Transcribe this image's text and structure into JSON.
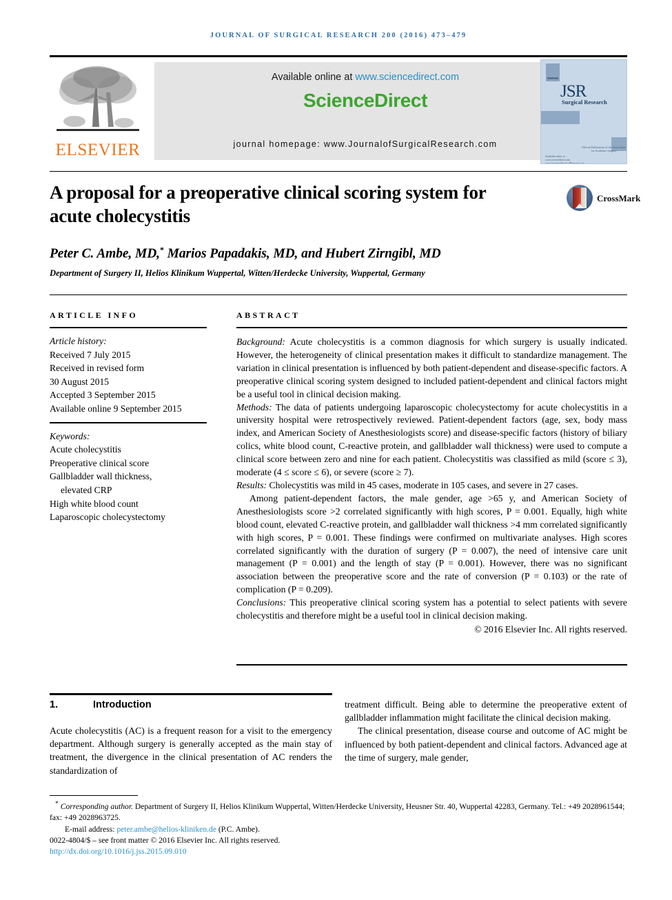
{
  "running_head": "JOURNAL OF SURGICAL RESEARCH 200 (2016) 473–479",
  "masthead": {
    "elsevier_wordmark": "ELSEVIER",
    "available_prefix": "Available online at ",
    "available_link": "www.sciencedirect.com",
    "sciencedirect_logo": "ScienceDirect",
    "journal_homepage": "journal homepage: www.JournalofSurgicalResearch.com",
    "cover": {
      "title": "JSR",
      "subtitle": "Surgical Research",
      "footer_line": "Official Publication of the Association for Academic Surgery",
      "footer_line2": "Available online at www.sciencedirect.com www.JournalofSurgicalResearch.com"
    }
  },
  "article": {
    "title": "A proposal for a preoperative clinical scoring system for acute cholecystitis",
    "crossmark_label": "CrossMark",
    "authors": "Peter C. Ambe, MD,",
    "authors_rest": " Marios Papadakis, MD, and Hubert Zirngibl, MD",
    "author_marker": "*",
    "affiliation": "Department of Surgery II, Helios Klinikum Wuppertal, Witten/Herdecke University, Wuppertal, Germany"
  },
  "article_info": {
    "heading": "ARTICLE INFO",
    "history_label": "Article history:",
    "history": [
      "Received 7 July 2015",
      "Received in revised form",
      "30 August 2015",
      "Accepted 3 September 2015",
      "Available online 9 September 2015"
    ],
    "keywords_label": "Keywords:",
    "keywords": [
      "Acute cholecystitis",
      "Preoperative clinical score",
      "Gallbladder wall thickness,",
      "elevated CRP",
      "High white blood count",
      "Laparoscopic cholecystectomy"
    ]
  },
  "abstract": {
    "heading": "ABSTRACT",
    "background_label": "Background:",
    "background": " Acute cholecystitis is a common diagnosis for which surgery is usually indicated. However, the heterogeneity of clinical presentation makes it difficult to standardize management. The variation in clinical presentation is influenced by both patient-dependent and disease-specific factors. A preoperative clinical scoring system designed to included patient-dependent and clinical factors might be a useful tool in clinical decision making.",
    "methods_label": "Methods:",
    "methods": " The data of patients undergoing laparoscopic cholecystectomy for acute cholecystitis in a university hospital were retrospectively reviewed. Patient-dependent factors (age, sex, body mass index, and American Society of Anesthesiologists score) and disease-specific factors (history of biliary colics, white blood count, C-reactive protein, and gallbladder wall thickness) were used to compute a clinical score between zero and nine for each patient. Cholecystitis was classified as mild (score ≤ 3), moderate (4 ≤ score ≤ 6), or severe (score ≥ 7).",
    "results_label": "Results:",
    "results": " Cholecystitis was mild in 45 cases, moderate in 105 cases, and severe in 27 cases.",
    "results_para2": "Among patient-dependent factors, the male gender, age >65 y, and American Society of Anesthesiologists score >2 correlated significantly with high scores, P = 0.001. Equally, high white blood count, elevated C-reactive protein, and gallbladder wall thickness >4 mm correlated significantly with high scores, P = 0.001. These findings were confirmed on multivariate analyses. High scores correlated significantly with the duration of surgery (P = 0.007), the need of intensive care unit management (P = 0.001) and the length of stay (P = 0.001). However, there was no significant association between the preoperative score and the rate of conversion (P = 0.103) or the rate of complication (P = 0.209).",
    "conclusions_label": "Conclusions:",
    "conclusions": " This preoperative clinical scoring system has a potential to select patients with severe cholecystitis and therefore might be a useful tool in clinical decision making.",
    "copyright": "© 2016 Elsevier Inc. All rights reserved."
  },
  "body": {
    "section_number": "1.",
    "section_title": "Introduction",
    "left_para": "Acute cholecystitis (AC) is a frequent reason for a visit to the emergency department. Although surgery is generally accepted as the main stay of treatment, the divergence in the clinical presentation of AC renders the standardization of",
    "right_para1": "treatment difficult. Being able to determine the preoperative extent of gallbladder inflammation might facilitate the clinical decision making.",
    "right_para2": "The clinical presentation, disease course and outcome of AC might be influenced by both patient-dependent and clinical factors. Advanced age at the time of surgery, male gender,"
  },
  "footnotes": {
    "corresponding_marker": "*",
    "corresponding_lead": "Corresponding author.",
    "corresponding_rest": " Department of Surgery II, Helios Klinikum Wuppertal, Witten/Herdecke University, Heusner Str. 40, Wuppertal 42283, Germany. Tel.: +49 2028961544; fax: +49 2028963725.",
    "email_label": "E-mail address:",
    "email": "peter.ambe@helios-kliniken.de",
    "email_suffix": " (P.C. Ambe).",
    "issn_line": "0022-4804/$ – see front matter © 2016 Elsevier Inc. All rights reserved.",
    "doi": "http://dx.doi.org/10.1016/j.jss.2015.09.010"
  }
}
